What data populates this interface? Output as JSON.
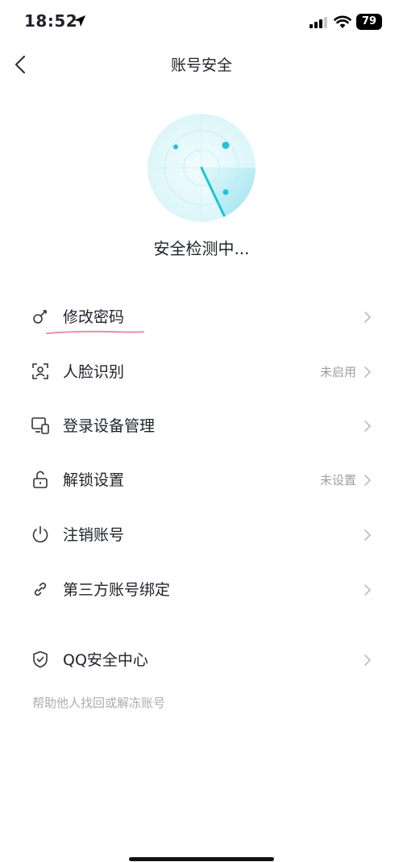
{
  "status_bar": {
    "time": "18:52",
    "battery": "79"
  },
  "nav": {
    "title": "账号安全"
  },
  "scan": {
    "status": "安全检测中..."
  },
  "menu": {
    "items": [
      {
        "label": "修改密码",
        "status": "",
        "icon": "key-icon"
      },
      {
        "label": "人脸识别",
        "status": "未启用",
        "icon": "face-scan-icon"
      },
      {
        "label": "登录设备管理",
        "status": "",
        "icon": "devices-icon"
      },
      {
        "label": "解锁设置",
        "status": "未设置",
        "icon": "unlock-icon"
      },
      {
        "label": "注销账号",
        "status": "",
        "icon": "power-icon"
      },
      {
        "label": "第三方账号绑定",
        "status": "",
        "icon": "link-icon"
      }
    ],
    "security_center": {
      "label": "QQ安全中心",
      "icon": "shield-check-icon"
    }
  },
  "help_text": "帮助他人找回或解冻账号",
  "colors": {
    "accent": "#1ec4d6",
    "radar_bg": "#e6f8fb",
    "annotation": "#f08aa8"
  }
}
